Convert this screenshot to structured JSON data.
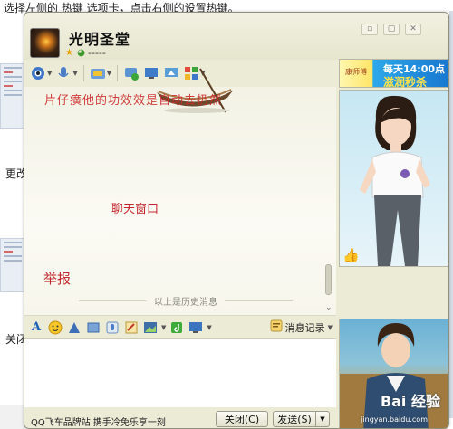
{
  "background": {
    "instruction": "选择左侧的 热键 选项卡，点击右侧的设置热键。",
    "side_texts": [
      "更改",
      "关闭"
    ]
  },
  "window": {
    "title": "光明圣堂",
    "signature": "-----",
    "controls": [
      "min",
      "max",
      "close"
    ]
  },
  "toolbar": {
    "icons": [
      "video-icon",
      "voice-icon",
      "file-transfer-icon",
      "add-friend-icon",
      "remote-assist-icon",
      "share-screen-icon",
      "apps-icon"
    ]
  },
  "chat": {
    "top_red_text": "片仔癀他的功效效是自动去扔然",
    "window_label": "聊天窗口",
    "report_label": "举报",
    "history_divider": "以上是历史消息"
  },
  "input_bar": {
    "tools": [
      "font-icon",
      "emoji-icon",
      "nudge-icon",
      "screenshot-icon",
      "voice-message-icon",
      "doodle-icon",
      "image-icon",
      "music-icon",
      "screen-share-icon"
    ],
    "history_label": "消息记录"
  },
  "footer": {
    "ad_text": "QQ飞车品牌站 携手冷免乐享一刻",
    "close_label": "关闭(C)",
    "send_label": "发送(S)"
  },
  "ads": {
    "banner_brand": "康师傅",
    "banner_line1": "每天14:00点",
    "banner_line2": "滋润秒杀",
    "watermark": "Bai 经验",
    "watermark_url": "jingyan.baidu.com"
  },
  "colors": {
    "window_bg": "#ecebd6",
    "accent_red": "#c4282f",
    "icon_blue": "#2c5d9c"
  }
}
